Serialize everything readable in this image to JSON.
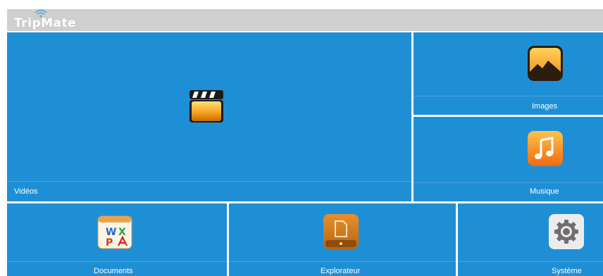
{
  "app": {
    "name": "TripMate",
    "logo_icon": "wifi-signal-icon"
  },
  "tiles": {
    "videos": {
      "label": "Vidéos",
      "icon": "clapperboard-icon"
    },
    "images": {
      "label": "Images",
      "icon": "landscape-photo-icon"
    },
    "music": {
      "label": "Musique",
      "icon": "music-note-icon"
    },
    "documents": {
      "label": "Documents",
      "icon": "office-documents-icon"
    },
    "explorer": {
      "label": "Explorateur",
      "icon": "file-explorer-icon"
    },
    "system": {
      "label": "Système",
      "icon": "gear-icon"
    }
  },
  "colors": {
    "tile_blue": "#1f8fd5",
    "header_gray": "#cfcfcf"
  }
}
